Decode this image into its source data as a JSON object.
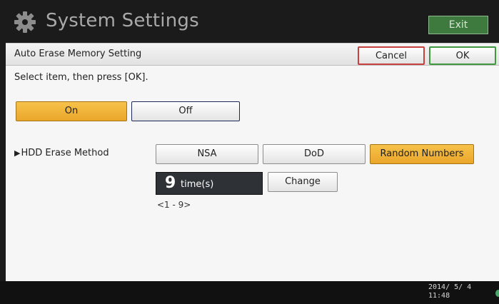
{
  "titlebar": {
    "title": "System Settings",
    "icon": "gear-icon",
    "exit_label": "Exit"
  },
  "subheader": {
    "title": "Auto Erase Memory Setting",
    "cancel_label": "Cancel",
    "ok_label": "OK"
  },
  "instruction": "Select item, then press [OK].",
  "auto_erase": {
    "options": [
      {
        "label": "On",
        "selected": true
      },
      {
        "label": "Off",
        "selected": false
      }
    ]
  },
  "hdd_erase": {
    "label": "HDD Erase Method",
    "methods": [
      {
        "label": "NSA",
        "selected": false
      },
      {
        "label": "DoD",
        "selected": false
      },
      {
        "label": "Random Numbers",
        "selected": true
      }
    ],
    "count": {
      "value": "9",
      "unit": "time(s)",
      "change_label": "Change",
      "range": "<1 - 9>"
    }
  },
  "status": {
    "date": "2014/ 5/ 4",
    "time": "11:48"
  },
  "colors": {
    "selected": "#f0b33a",
    "exit_green": "#3e7a3e",
    "cancel_border": "#c94040",
    "ok_border": "#3f9a3f"
  }
}
